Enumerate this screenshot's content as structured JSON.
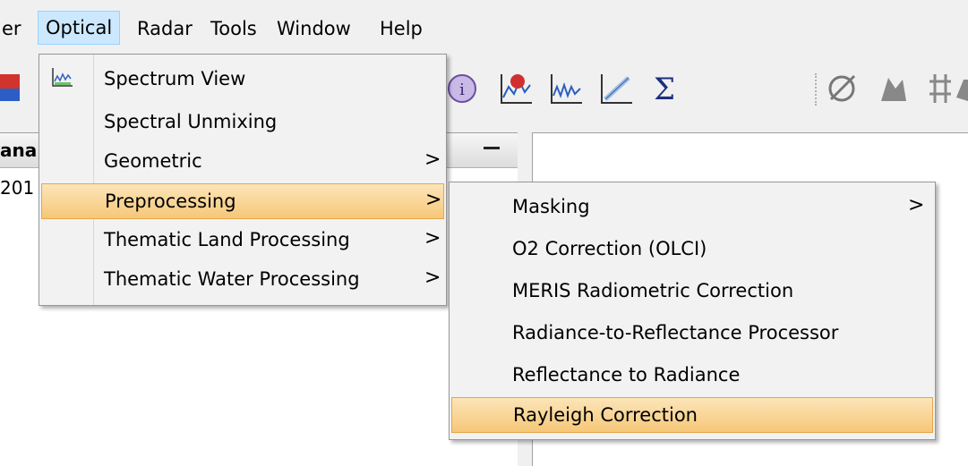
{
  "menubar": {
    "items": [
      "er",
      "Optical",
      "Radar",
      "Tools",
      "Window",
      "Help"
    ]
  },
  "panel": {
    "title_fragment": "ana",
    "row_fragment": "201"
  },
  "optical_menu": {
    "items": [
      {
        "label": "Spectrum View",
        "icon": "spectrum-view-icon",
        "submenu": false
      },
      {
        "label": "Spectral Unmixing",
        "submenu": false
      },
      {
        "label": "Geometric",
        "submenu": true
      },
      {
        "label": "Preprocessing",
        "submenu": true,
        "highlighted": true
      },
      {
        "label": "Thematic Land Processing",
        "submenu": true
      },
      {
        "label": "Thematic Water Processing",
        "submenu": true
      }
    ],
    "arrow": ">"
  },
  "preprocessing_menu": {
    "items": [
      {
        "label": "Masking",
        "submenu": true
      },
      {
        "label": "O2 Correction (OLCI)",
        "submenu": false
      },
      {
        "label": "MERIS Radiometric Correction",
        "submenu": false
      },
      {
        "label": "Radiance-to-Reflectance Processor",
        "submenu": false
      },
      {
        "label": "Reflectance to Radiance",
        "submenu": false
      },
      {
        "label": "Rayleigh Correction",
        "submenu": false,
        "highlighted": true
      }
    ],
    "arrow": ">"
  },
  "toolbar": {
    "icons": [
      "product-library-icon",
      "information-icon",
      "spectrum-plot-icon",
      "profile-plot-icon",
      "scatter-plot-icon",
      "statistics-sum-icon",
      "layer-remove-icon",
      "pin-manager-icon",
      "graticule-icon",
      "world-map-icon"
    ]
  },
  "colors": {
    "menu_highlight": "#cce8ff",
    "item_highlight": "#f6c778",
    "item_highlight_border": "#e5a64a"
  }
}
